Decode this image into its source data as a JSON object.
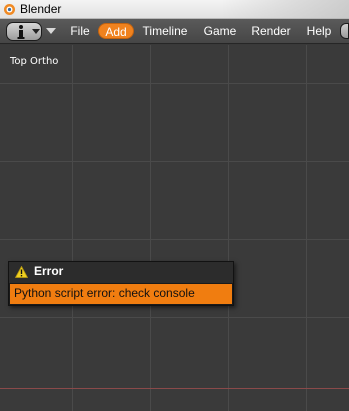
{
  "window": {
    "title": "Blender"
  },
  "menubar": {
    "editor_type_icon": "info-icon",
    "items": [
      {
        "label": "File",
        "active": false
      },
      {
        "label": "Add",
        "active": true
      },
      {
        "label": "Timeline",
        "active": false
      },
      {
        "label": "Game",
        "active": false
      },
      {
        "label": "Render",
        "active": false
      },
      {
        "label": "Help",
        "active": false
      }
    ]
  },
  "viewport": {
    "view_label": "Top Ortho"
  },
  "error_popup": {
    "title": "Error",
    "icon": "warning-icon",
    "message": "Python script error: check console"
  },
  "colors": {
    "accent": "#f0821e",
    "viewport_bg": "#3a3a3a",
    "grid_line": "#4a4a4a",
    "x_axis": "#8a4a4a"
  }
}
